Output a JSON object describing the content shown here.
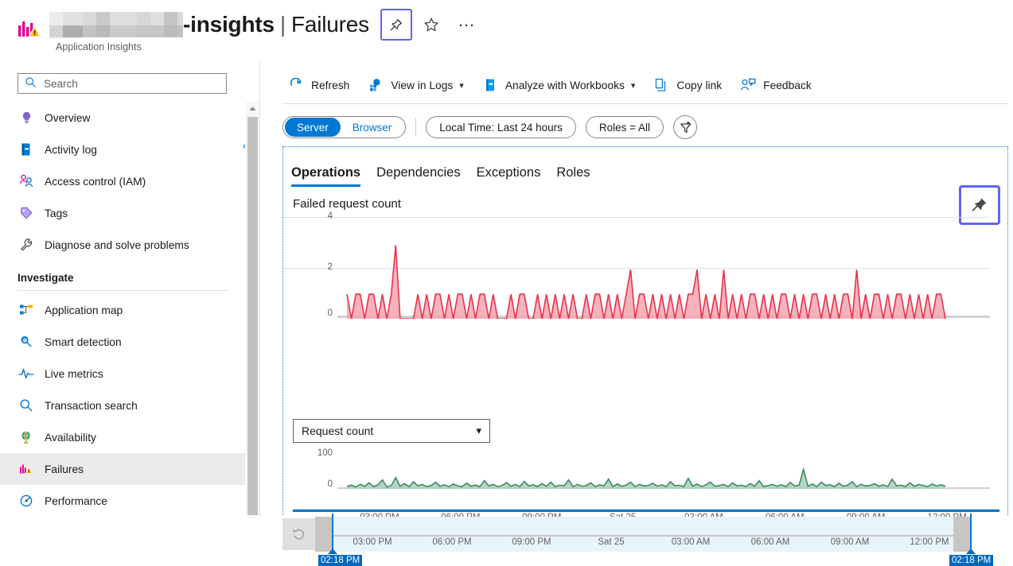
{
  "header": {
    "resource_name_redacted": "",
    "name_suffix": "-insights",
    "separator": "|",
    "page_name": "Failures",
    "subtitle": "Application Insights",
    "pin_label": "Pin",
    "favorite_label": "Add to favorites",
    "more_label": "More"
  },
  "sidebar": {
    "search": {
      "placeholder": "Search",
      "value": ""
    },
    "collapse_label": "Collapse",
    "items": [
      {
        "label": "Overview",
        "icon": "lightbulb-icon",
        "active": false
      },
      {
        "label": "Activity log",
        "icon": "activity-log-icon",
        "active": false
      },
      {
        "label": "Access control (IAM)",
        "icon": "people-icon",
        "active": false
      },
      {
        "label": "Tags",
        "icon": "tag-icon",
        "active": false
      },
      {
        "label": "Diagnose and solve problems",
        "icon": "wrench-icon",
        "active": false
      }
    ],
    "group_label": "Investigate",
    "investigate_items": [
      {
        "label": "Application map",
        "icon": "app-map-icon",
        "active": false
      },
      {
        "label": "Smart detection",
        "icon": "smart-detection-icon",
        "active": false
      },
      {
        "label": "Live metrics",
        "icon": "live-metrics-icon",
        "active": false
      },
      {
        "label": "Transaction search",
        "icon": "search-icon",
        "active": false
      },
      {
        "label": "Availability",
        "icon": "globe-icon",
        "active": false
      },
      {
        "label": "Failures",
        "icon": "failures-icon",
        "active": true
      },
      {
        "label": "Performance",
        "icon": "performance-icon",
        "active": false
      }
    ]
  },
  "toolbar": [
    {
      "label": "Refresh",
      "icon": "refresh-icon",
      "caret": false
    },
    {
      "label": "View in Logs",
      "icon": "logs-icon",
      "caret": true
    },
    {
      "label": "Analyze with Workbooks",
      "icon": "workbooks-icon",
      "caret": true
    },
    {
      "label": "Copy link",
      "icon": "copy-icon",
      "caret": false
    },
    {
      "label": "Feedback",
      "icon": "feedback-icon",
      "caret": false
    }
  ],
  "filters": {
    "scope": {
      "options": [
        "Server",
        "Browser"
      ],
      "selected": "Server"
    },
    "time_range": "Local Time: Last 24 hours",
    "roles": "Roles = All",
    "add_filter_label": "Add filter"
  },
  "tabs": [
    {
      "label": "Operations",
      "selected": true
    },
    {
      "label": "Dependencies",
      "selected": false
    },
    {
      "label": "Exceptions",
      "selected": false
    },
    {
      "label": "Roles",
      "selected": false
    }
  ],
  "chart_panel": {
    "title": "Failed request count",
    "pin_label": "Pin chart",
    "metric_select": {
      "value": "Request count",
      "caret": "chevron-down-icon"
    }
  },
  "scrubber": {
    "reset_label": "Reset zoom",
    "start_time": "02:18 PM",
    "end_time": "02:18 PM",
    "ticks": [
      "03:00 PM",
      "06:00 PM",
      "09:00 PM",
      "Sat 25",
      "03:00 AM",
      "06:00 AM",
      "09:00 AM",
      "12:00 PM"
    ]
  },
  "colors": {
    "accent": "#0078d4",
    "failed_line": "#e8334a",
    "failed_fill": "#f5a6b0",
    "request_line": "#3d8a5f",
    "request_fill": "#a9cfba",
    "focus_ring": "#6264f0",
    "active_nav": "#edebe9"
  },
  "chart_data": [
    {
      "type": "area",
      "title": "Failed request count",
      "ylabel": "",
      "xlabel": "",
      "ylim": [
        0,
        4.4
      ],
      "yticks": [
        0,
        2,
        4
      ],
      "grid": true,
      "line_color": "#e8334a",
      "fill_color": "#f5a6b0",
      "xticks": [
        "03:00 PM",
        "06:00 PM",
        "09:00 PM",
        "Sat 25",
        "03:00 AM",
        "06:00 AM",
        "09:00 AM",
        "12:00 PM"
      ],
      "x_start": "02:18 PM",
      "x_end": "02:18 PM",
      "values": [
        1,
        0,
        1,
        1,
        0,
        1,
        1,
        0,
        1,
        0,
        1,
        3,
        0,
        0,
        0,
        0,
        1,
        0,
        1,
        0,
        1,
        1,
        0,
        1,
        0,
        1,
        1,
        0,
        1,
        0,
        1,
        1,
        0,
        1,
        0,
        0,
        0,
        1,
        0,
        1,
        1,
        0,
        0,
        1,
        0,
        1,
        0,
        1,
        0,
        1,
        0,
        1,
        0,
        0,
        1,
        0,
        1,
        1,
        0,
        1,
        0,
        1,
        0,
        1,
        2,
        0,
        1,
        1,
        0,
        1,
        0,
        1,
        0,
        1,
        0,
        1,
        0,
        1,
        1,
        2,
        0,
        1,
        0,
        1,
        0,
        2,
        0,
        1,
        0,
        1,
        0,
        1,
        1,
        0,
        1,
        0,
        1,
        0,
        1,
        1,
        0,
        1,
        0,
        1,
        0,
        1,
        1,
        0,
        1,
        0,
        1,
        0,
        1,
        1,
        0,
        2,
        0,
        1,
        0,
        1,
        1,
        0,
        1,
        0,
        1,
        1,
        0,
        1,
        0,
        1,
        0,
        1,
        0,
        1,
        1,
        0
      ]
    },
    {
      "type": "area",
      "title": "Request count",
      "ylabel": "",
      "xlabel": "",
      "ylim": [
        0,
        110
      ],
      "yticks": [
        0,
        100
      ],
      "grid": false,
      "line_color": "#3d8a5f",
      "fill_color": "#a9cfba",
      "xticks": [
        "03:00 PM",
        "06:00 PM",
        "09:00 PM",
        "Sat 25",
        "03:00 AM",
        "06:00 AM",
        "09:00 AM",
        "12:00 PM"
      ],
      "x_start": "02:18 PM",
      "x_end": "02:18 PM",
      "values": [
        6,
        10,
        5,
        12,
        7,
        16,
        6,
        11,
        24,
        5,
        9,
        30,
        7,
        14,
        6,
        19,
        8,
        12,
        6,
        9,
        18,
        7,
        11,
        6,
        13,
        8,
        6,
        15,
        7,
        10,
        6,
        22,
        8,
        12,
        6,
        9,
        17,
        7,
        12,
        6,
        20,
        8,
        11,
        6,
        14,
        7,
        18,
        6,
        10,
        8,
        24,
        6,
        12,
        7,
        9,
        16,
        6,
        11,
        8,
        26,
        6,
        13,
        7,
        10,
        18,
        6,
        12,
        8,
        9,
        15,
        7,
        11,
        6,
        19,
        8,
        10,
        6,
        28,
        7,
        13,
        6,
        11,
        18,
        7,
        9,
        12,
        6,
        16,
        8,
        10,
        6,
        14,
        7,
        22,
        6,
        9,
        12,
        7,
        11,
        6,
        17,
        8,
        10,
        52,
        7,
        13,
        6,
        18,
        9,
        11,
        6,
        15,
        7,
        10,
        19,
        6,
        12,
        8,
        9,
        14,
        7,
        11,
        6,
        26,
        8,
        10,
        6,
        16,
        7,
        12,
        9,
        6,
        13,
        8,
        11,
        7
      ]
    }
  ]
}
